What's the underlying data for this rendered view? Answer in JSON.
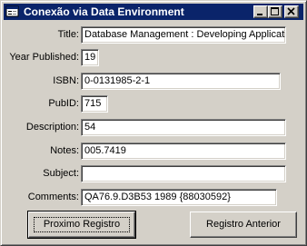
{
  "window": {
    "title": "Conexão via Data Environment",
    "icon": "form-icon",
    "controls": [
      "minimize-icon",
      "maximize-icon",
      "close-icon"
    ]
  },
  "fields": [
    {
      "label": "Title:",
      "value": "Database Management : Developing Applicati"
    },
    {
      "label": "Year Published:",
      "value": "19"
    },
    {
      "label": "ISBN:",
      "value": "0-0131985-2-1"
    },
    {
      "label": "PubID:",
      "value": "715"
    },
    {
      "label": "Description:",
      "value": "54"
    },
    {
      "label": "Notes:",
      "value": "005.7419"
    },
    {
      "label": "Subject:",
      "value": ""
    },
    {
      "label": "Comments:",
      "value": "QA76.9.D3B53 1989 {88030592}"
    }
  ],
  "buttons": {
    "next": "Proximo Registro",
    "previous": "Registro Anterior"
  },
  "colors": {
    "titlebar": "#0a246a",
    "face": "#d4d0c8",
    "field_bg": "#ffffff"
  }
}
